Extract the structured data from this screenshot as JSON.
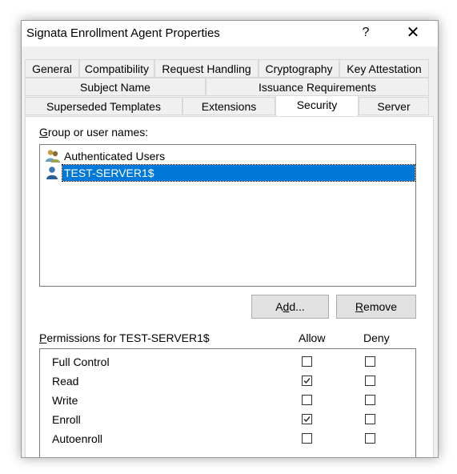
{
  "window": {
    "title": "Signata Enrollment Agent Properties",
    "help_glyph": "?",
    "close_glyph": "✕"
  },
  "tabs": {
    "row1": [
      "General",
      "Compatibility",
      "Request Handling",
      "Cryptography",
      "Key Attestation"
    ],
    "row2": [
      "Subject Name",
      "Issuance Requirements"
    ],
    "row3": [
      "Superseded Templates",
      "Extensions",
      "Security",
      "Server"
    ],
    "active": "Security"
  },
  "security": {
    "group_label_prefix": "G",
    "group_label_rest": "roup or user names:",
    "users": [
      {
        "name": "Authenticated Users",
        "icon": "users-group-icon",
        "selected": false
      },
      {
        "name": "TEST-SERVER1$",
        "icon": "user-computer-icon",
        "selected": true
      }
    ],
    "add_pre": "A",
    "add_u": "d",
    "add_post": "d...",
    "remove_u": "R",
    "remove_post": "emove",
    "perm_label_u": "P",
    "perm_label_rest": "ermissions for TEST-SERVER1$",
    "col_allow": "Allow",
    "col_deny": "Deny",
    "permissions": [
      {
        "name": "Full Control",
        "allow": false,
        "deny": false
      },
      {
        "name": "Read",
        "allow": true,
        "deny": false
      },
      {
        "name": "Write",
        "allow": false,
        "deny": false
      },
      {
        "name": "Enroll",
        "allow": true,
        "deny": false
      },
      {
        "name": "Autoenroll",
        "allow": false,
        "deny": false
      }
    ]
  },
  "colors": {
    "selection": "#0078d7",
    "face": "#f0f0f0"
  }
}
